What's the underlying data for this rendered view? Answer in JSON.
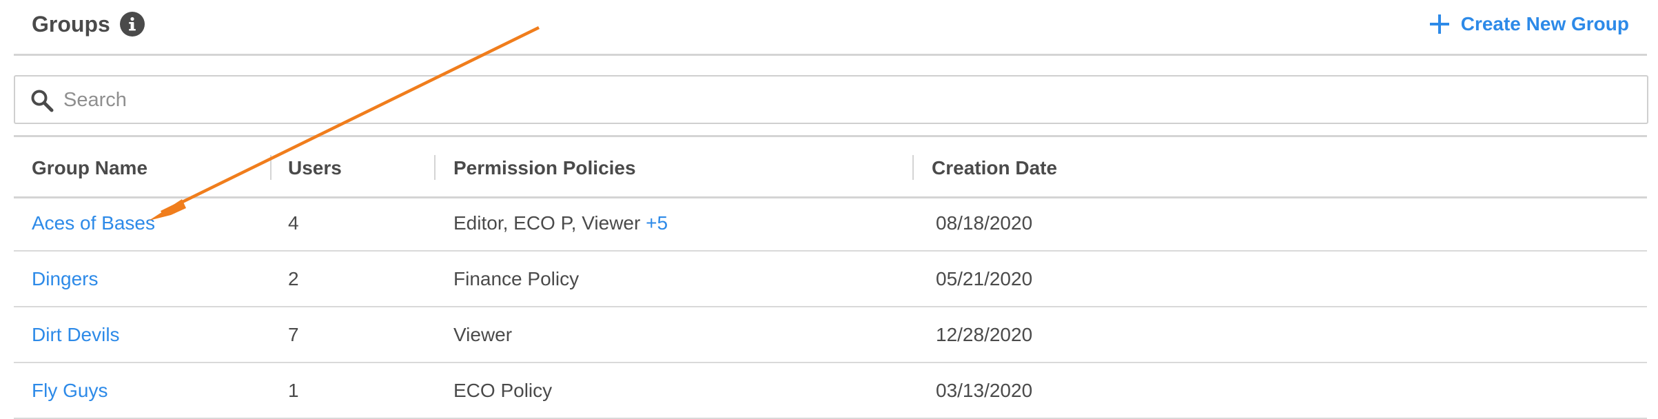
{
  "header": {
    "title": "Groups",
    "create_label": "Create New Group"
  },
  "search": {
    "placeholder": "Search",
    "value": ""
  },
  "table": {
    "columns": [
      "Group Name",
      "Users",
      "Permission Policies",
      "Creation Date"
    ],
    "rows": [
      {
        "name": "Aces of Bases",
        "users": "4",
        "policies": "Editor, ECO P, Viewer",
        "more": "+5",
        "created": "08/18/2020"
      },
      {
        "name": "Dingers",
        "users": "2",
        "policies": "Finance Policy",
        "more": "",
        "created": "05/21/2020"
      },
      {
        "name": "Dirt Devils",
        "users": "7",
        "policies": "Viewer",
        "more": "",
        "created": "12/28/2020"
      },
      {
        "name": "Fly Guys",
        "users": "1",
        "policies": "ECO Policy",
        "more": "",
        "created": "03/13/2020"
      }
    ]
  },
  "colors": {
    "accent": "#2d8ae8",
    "text": "#4a4a4a",
    "annotation": "#f07d1c"
  },
  "icons": {
    "info": "info-icon",
    "create": "plus-icon",
    "search": "search-icon",
    "annotation": "arrow-annotation"
  }
}
